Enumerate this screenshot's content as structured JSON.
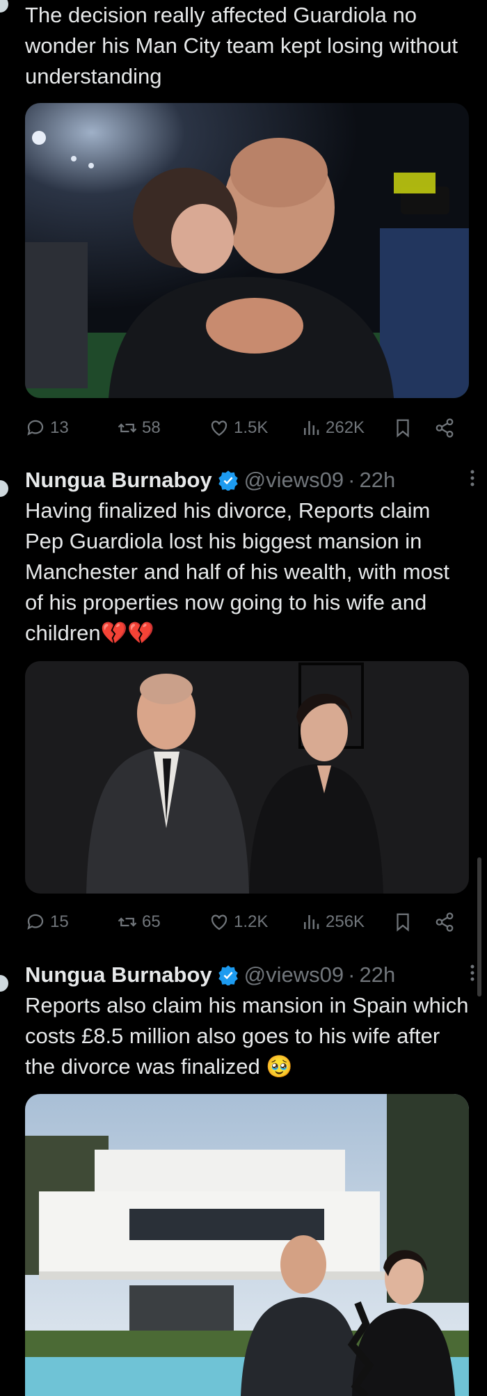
{
  "tweets": [
    {
      "text": "The decision really affected Guardiola no wonder his Man City team kept losing without understanding",
      "image_alt": "Guardiola embracing his wife on a stadium pitch surrounded by photographers",
      "stats": {
        "replies": "13",
        "reposts": "58",
        "likes": "1.5K",
        "views": "262K"
      }
    },
    {
      "author": {
        "name": "Nungua Burnaboy",
        "handle": "@views09",
        "time": "22h"
      },
      "text": "Having finalized his divorce,  Reports claim Pep Guardiola lost his biggest mansion in Manchester and half of his wealth, with most of his properties now going to his wife and children💔💔",
      "image_alt": "Guardiola and his wife in dark clothing on a black background",
      "stats": {
        "replies": "15",
        "reposts": "65",
        "likes": "1.2K",
        "views": "256K"
      }
    },
    {
      "author": {
        "name": "Nungua Burnaboy",
        "handle": "@views09",
        "time": "22h"
      },
      "text": "Reports also claim his mansion in Spain which costs £8.5 million also goes to his wife after the divorce was finalized 🥹",
      "image_alt": "White modern mansion with pool, Guardiola and wife overlaid with a crack between them"
    }
  ],
  "colors": {
    "accent": "#1d9bf0",
    "muted": "#71767b",
    "text": "#e7e9ea",
    "background": "#000000"
  },
  "separator": "·"
}
